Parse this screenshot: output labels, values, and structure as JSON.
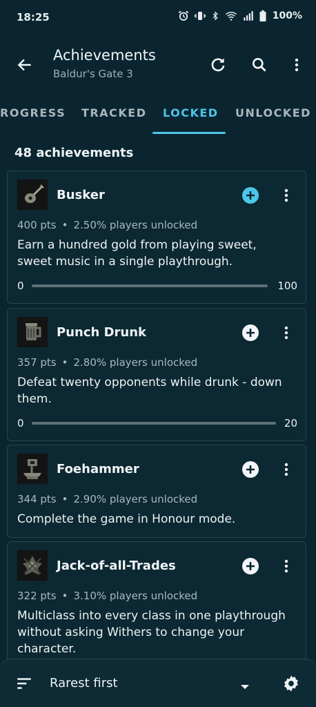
{
  "status_bar": {
    "time": "18:25",
    "battery": "100%",
    "icons": [
      "alarm-icon",
      "vibrate-icon",
      "bluetooth-icon",
      "wifi-icon",
      "signal-icon",
      "battery-icon"
    ]
  },
  "app_bar": {
    "title": "Achievements",
    "subtitle": "Baldur's Gate 3",
    "actions": [
      "back-arrow-icon",
      "refresh-icon",
      "search-icon",
      "more-vert-icon"
    ]
  },
  "tabs": [
    {
      "label": "ROGRESS",
      "active": false
    },
    {
      "label": "TRACKED",
      "active": false
    },
    {
      "label": "LOCKED",
      "active": true
    },
    {
      "label": "UNLOCKED",
      "active": false
    }
  ],
  "list": {
    "count_label": "48 achievements",
    "items": [
      {
        "name": "Busker",
        "points": "400 pts",
        "players": "2.50% players unlocked",
        "description": "Earn a hundred gold from playing sweet, sweet music in a single playthrough.",
        "progress_start": "0",
        "progress_end": "100",
        "tracked": false,
        "icon": "lute-icon"
      },
      {
        "name": "Punch Drunk",
        "points": "357 pts",
        "players": "2.80% players unlocked",
        "description": "Defeat twenty opponents while drunk - down them.",
        "progress_start": "0",
        "progress_end": "20",
        "tracked": false,
        "icon": "tankard-icon"
      },
      {
        "name": "Foehammer",
        "points": "344 pts",
        "players": "2.90% players unlocked",
        "description": "Complete the game in Honour mode.",
        "tracked": false,
        "icon": "helmet-anvil-icon"
      },
      {
        "name": "Jack-of-all-Trades",
        "points": "322 pts",
        "players": "3.10% players unlocked",
        "description": "Multiclass into every class in one playthrough without asking Withers to change your character.",
        "tracked": false,
        "icon": "emblem-icon"
      }
    ]
  },
  "separator": "•",
  "bottom_bar": {
    "sort_label": "Rarest first",
    "icons": [
      "sort-icon",
      "dropdown-arrow-icon",
      "settings-gear-icon"
    ]
  },
  "colors": {
    "background": "#0a2530",
    "accent": "#4cc6e8",
    "card_border": "#2a4550",
    "text_primary": "#eef3f5",
    "text_secondary": "#a8b9c0"
  }
}
